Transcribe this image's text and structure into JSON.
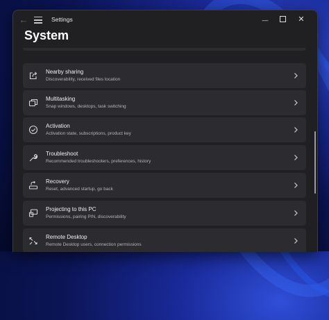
{
  "app": {
    "title": "Settings"
  },
  "page": {
    "title": "System"
  },
  "window_controls": {
    "minimize": "—",
    "close": "✕"
  },
  "items": [
    {
      "label": "Nearby sharing",
      "description": "Discoverability, received files location",
      "icon": "share-icon"
    },
    {
      "label": "Multitasking",
      "description": "Snap windows, desktops, task switching",
      "icon": "multitasking-icon"
    },
    {
      "label": "Activation",
      "description": "Activation state, subscriptions, product key",
      "icon": "activation-check-icon"
    },
    {
      "label": "Troubleshoot",
      "description": "Recommended troubleshooters, preferences, history",
      "icon": "wrench-icon"
    },
    {
      "label": "Recovery",
      "description": "Reset, advanced startup, go back",
      "icon": "recovery-icon"
    },
    {
      "label": "Projecting to this PC",
      "description": "Permissions, pairing PIN, discoverability",
      "icon": "projecting-icon"
    },
    {
      "label": "Remote Desktop",
      "description": "Remote Desktop users, connection permissions",
      "icon": "remote-desktop-icon"
    }
  ]
}
